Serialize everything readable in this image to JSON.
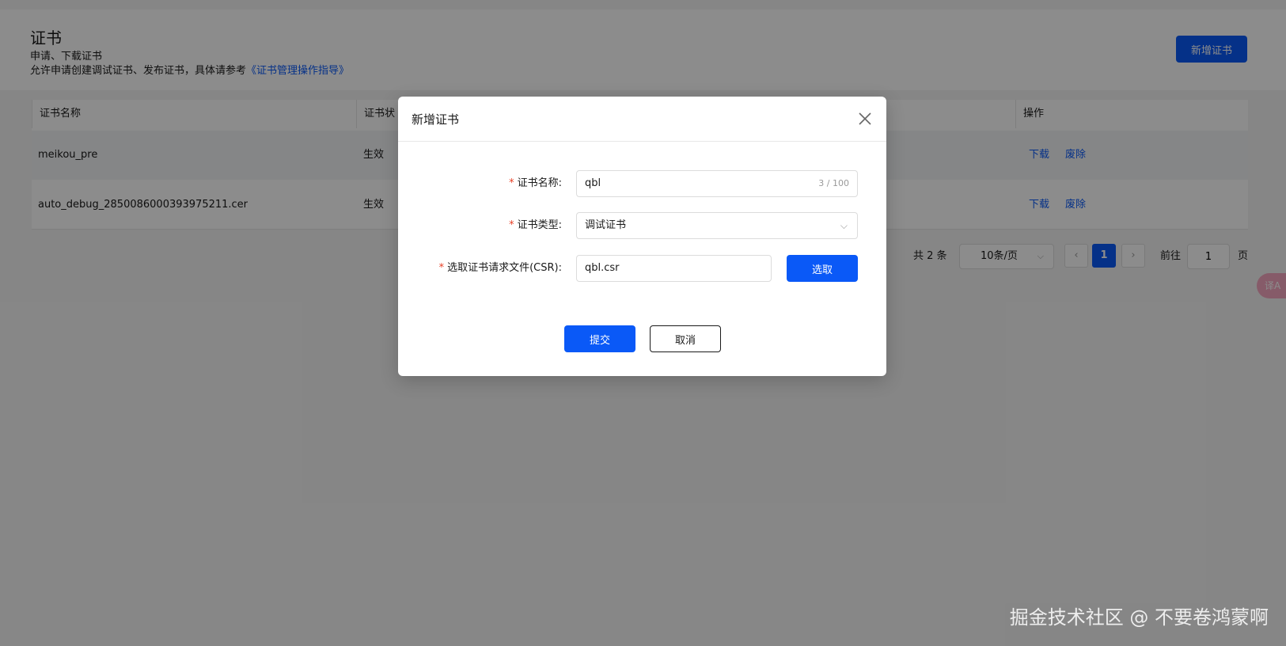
{
  "header": {
    "title": "证书",
    "subtitle": "申请、下载证书",
    "desc_prefix": "允许申请创建调试证书、发布证书，具体请参考",
    "guide_link": "《证书管理操作指导》",
    "add_button": "新增证书"
  },
  "table": {
    "columns": [
      "证书名称",
      "证书状",
      "操作"
    ],
    "rows": [
      {
        "name": "meikou_pre",
        "status": "生效",
        "download": "下载",
        "revoke": "废除"
      },
      {
        "name": "auto_debug_2850086000393975211.cer",
        "status": "生效",
        "download": "下载",
        "revoke": "废除"
      }
    ]
  },
  "pager": {
    "total": "共 2 条",
    "page_size": "10条/页",
    "prev": "‹",
    "current": "1",
    "next": "›",
    "goto_label": "前往",
    "goto_value": "1",
    "page_label": "页"
  },
  "translate_fab": "译A",
  "modal": {
    "title": "新增证书",
    "close_icon": "close-icon",
    "fields": {
      "name_label": "证书名称:",
      "name_value": "qbl",
      "name_count": "3 / 100",
      "type_label": "证书类型:",
      "type_value": "调试证书",
      "file_label": "选取证书请求文件(CSR):",
      "file_value": "qbl.csr",
      "choose_button": "选取"
    },
    "required_mark": "*",
    "submit_button": "提交",
    "cancel_button": "取消"
  },
  "watermark": "掘金技术社区 @ 不要卷鸿蒙啊",
  "colors": {
    "primary": "#0a59f7",
    "required": "#e84026",
    "mask": "rgba(0,0,0,0.45)"
  }
}
